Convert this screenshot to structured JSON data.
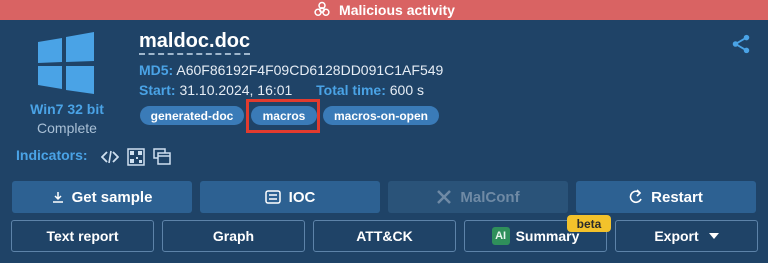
{
  "banner": {
    "text": "Malicious activity",
    "icon": "biohazard-icon",
    "color": "#d96363"
  },
  "file": {
    "name": "maldoc.doc"
  },
  "md5": {
    "label": "MD5:",
    "value": "A60F86192F4F09CD6128DD091C1AF549"
  },
  "start": {
    "label": "Start:",
    "value": "31.10.2024, 16:01"
  },
  "total_time": {
    "label": "Total time:",
    "value": "600 s"
  },
  "os": {
    "name": "Win7 32 bit",
    "status": "Complete",
    "icon": "windows-logo-icon"
  },
  "tags": [
    {
      "label": "generated-doc"
    },
    {
      "label": "macros",
      "highlighted": true
    },
    {
      "label": "macros-on-open"
    }
  ],
  "indicators": {
    "label": "Indicators:",
    "icons": [
      "code-icon",
      "qr-grid-icon",
      "windows-stack-icon"
    ]
  },
  "actions_row1": [
    {
      "label": "Get sample",
      "icon": "download-icon"
    },
    {
      "label": "IOC",
      "icon": "list-box-icon"
    },
    {
      "label": "MalConf",
      "icon": "tools-icon",
      "disabled": true
    },
    {
      "label": "Restart",
      "icon": "refresh-icon"
    }
  ],
  "actions_row2": [
    {
      "label": "Text report"
    },
    {
      "label": "Graph"
    },
    {
      "label": "ATT&CK"
    },
    {
      "label": "Summary",
      "badge": "AI",
      "flag": "beta"
    },
    {
      "label": "Export",
      "icon": "caret-down-icon"
    }
  ],
  "colors": {
    "background": "#1f4367",
    "accent": "#4aa3e6",
    "tag": "#3a7bb8",
    "highlight": "#e23b2e",
    "beta": "#f3c22b"
  }
}
